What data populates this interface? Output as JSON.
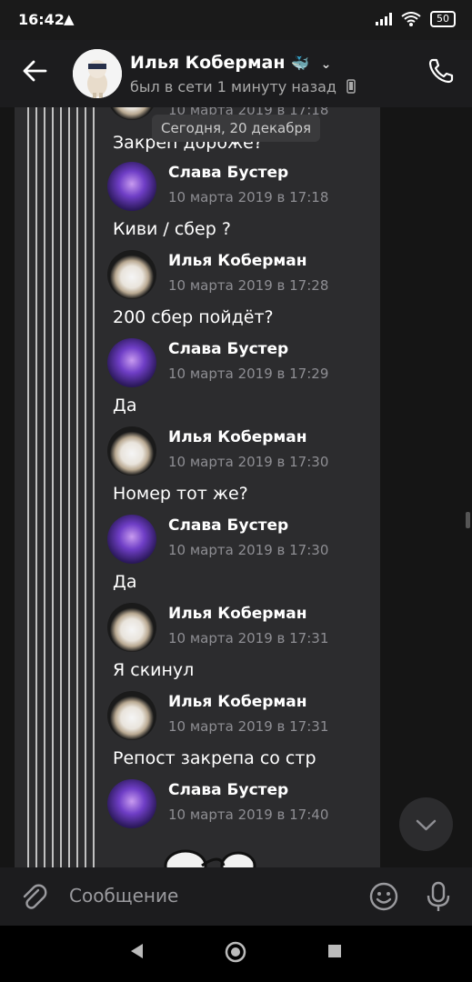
{
  "status_bar": {
    "time": "16:42",
    "warning_glyph": "▲",
    "battery": "50"
  },
  "header": {
    "contact_name": "Илья Коберман",
    "status": "был в сети 1 минуту назад",
    "icons": [
      "back-arrow-icon",
      "whale-icon",
      "chevron-down-icon",
      "mobile-icon",
      "phone-icon"
    ]
  },
  "date_pill": "Сегодня, 20 декабря",
  "top_fragment": {
    "time": "10 марта 2019 в 17:18",
    "text": "Закреп дороже?"
  },
  "messages": [
    {
      "author": "Слава Бустер",
      "time": "10 марта 2019 в 17:18",
      "text": "Киви / сбер ?"
    },
    {
      "author": "Илья Коберман",
      "time": "10 марта 2019 в 17:28",
      "text": "200 сбер пойдёт?"
    },
    {
      "author": "Слава Бустер",
      "time": "10 марта 2019 в 17:29",
      "text": "Да"
    },
    {
      "author": "Илья Коберман",
      "time": "10 марта 2019 в 17:30",
      "text": "Номер тот же?"
    },
    {
      "author": "Слава Бустер",
      "time": "10 марта 2019 в 17:30",
      "text": "Да"
    },
    {
      "author": "Илья Коберман",
      "time": "10 марта 2019 в 17:31",
      "text": "Я скинул"
    },
    {
      "author": "Илья Коберман",
      "time": "10 марта 2019 в 17:31",
      "text": "Репост закрепа со стр"
    },
    {
      "author": "Слава Бустер",
      "time": "10 марта 2019 в 17:40",
      "text": ""
    }
  ],
  "composer": {
    "placeholder": "Сообщение"
  },
  "colors": {
    "background": "#000000",
    "panel": "#2c2c2e",
    "header": "#1c1c1e",
    "muted_text": "#8e8e93"
  }
}
